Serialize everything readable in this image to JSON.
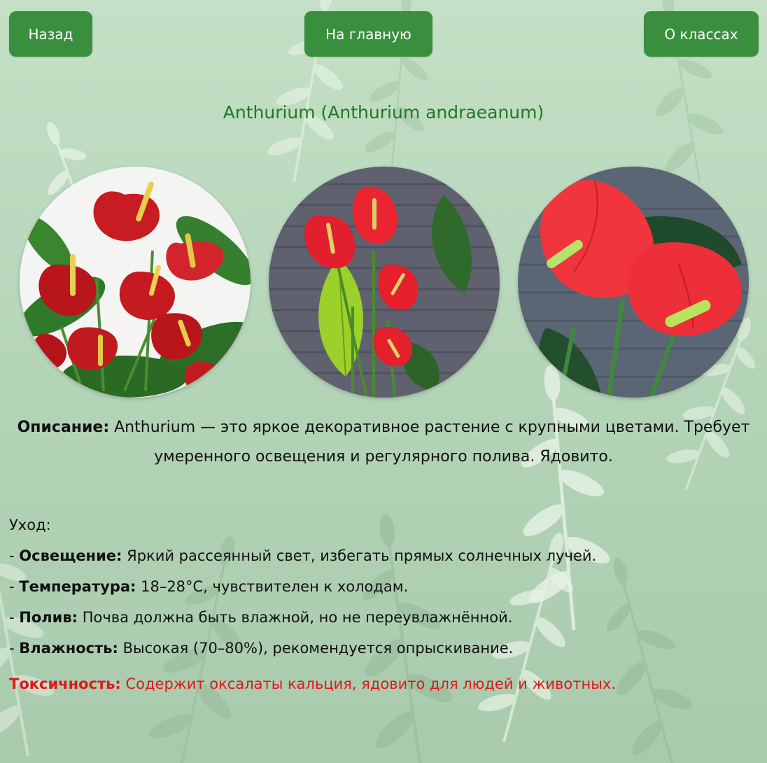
{
  "nav": {
    "back_label": "Назад",
    "home_label": "На главную",
    "classes_label": "О классах"
  },
  "title": "Anthurium (Anthurium andraeanum)",
  "description": {
    "label": "Описание:",
    "text": " Anthurium — это яркое декоративное растение с крупными цветами. Требует умеренного освещения и регулярного полива. Ядовито."
  },
  "care": {
    "heading": "Уход:",
    "items": [
      {
        "label": "Освещение:",
        "text": " Яркий рассеянный свет, избегать прямых солнечных лучей."
      },
      {
        "label": "Температура:",
        "text": " 18–28°C, чувствителен к холодам."
      },
      {
        "label": "Полив:",
        "text": " Почва должна быть влажной, но не переувлажнённой."
      },
      {
        "label": "Влажность:",
        "text": " Высокая (70–80%), рекомендуется опрыскивание."
      }
    ]
  },
  "toxicity": {
    "label": "Токсичность:",
    "text": " Содержит оксалаты кальция, ядовито для людей и животных."
  },
  "colors": {
    "button": "#3a8f3f",
    "title": "#1f7a23",
    "toxicity": "#e01818",
    "background": "#b9d8bd"
  },
  "photos": [
    "anthurium-photo",
    "anthurium-photo",
    "anthurium-photo"
  ]
}
